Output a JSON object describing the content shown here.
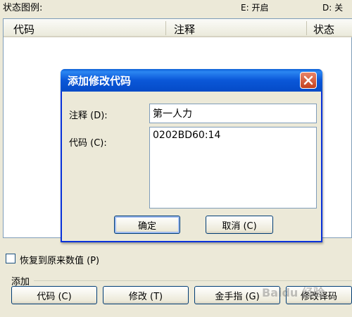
{
  "legend": {
    "title": "状态图例:",
    "enabled": "E: 开启",
    "disabled": "D: 关"
  },
  "list": {
    "columns": [
      "代码",
      "注释",
      "状态"
    ]
  },
  "dialog": {
    "title": "添加修改代码",
    "comment_label": "注释 (D):",
    "comment_value": "第一人力",
    "code_label": "代码 (C):",
    "code_value": "0202BD60:14",
    "ok_label": "确定",
    "cancel_label": "取消 (C)"
  },
  "restore_label": "恢复到原来数值 (P)",
  "add_group": {
    "title": "添加",
    "buttons": [
      "代码 (C)",
      "修改 (T)",
      "金手指 (G)",
      "修改译码"
    ]
  },
  "watermark": "Baidu 经验"
}
